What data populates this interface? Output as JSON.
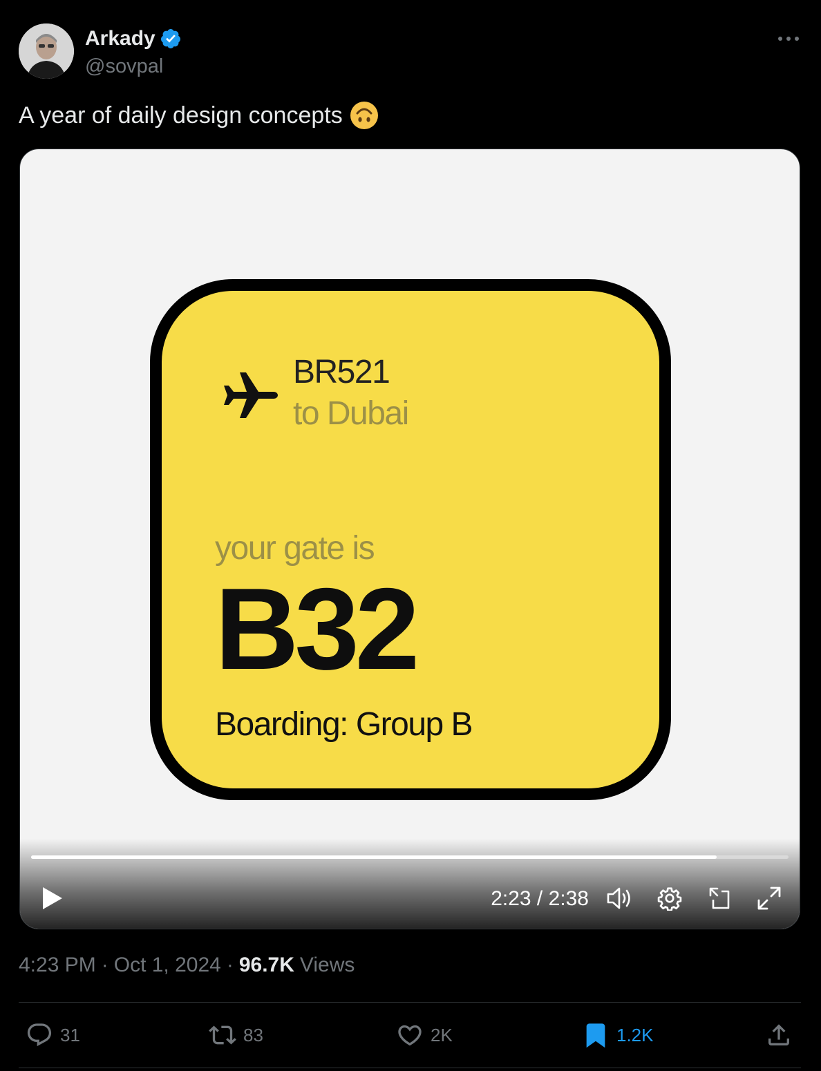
{
  "author": {
    "display_name": "Arkady",
    "handle": "@sovpal",
    "verified_color": "#1d9bf0"
  },
  "tweet": {
    "text": "A year of daily design concepts",
    "emoji_name": "upside-down-face"
  },
  "media": {
    "card": {
      "flight": "BR521",
      "destination": "to Dubai",
      "gate_label": "your gate is",
      "gate": "B32",
      "boarding": "Boarding: Group B",
      "accent_color": "#f7dc48"
    },
    "player": {
      "time": "2:23 / 2:38",
      "progress": 0.905
    }
  },
  "meta": {
    "time": "4:23 PM",
    "date": "Oct 1, 2024",
    "views_count": "96.7K",
    "views_label": "Views"
  },
  "actions": {
    "replies": "31",
    "reposts": "83",
    "likes": "2K",
    "bookmarks": "1.2K"
  }
}
